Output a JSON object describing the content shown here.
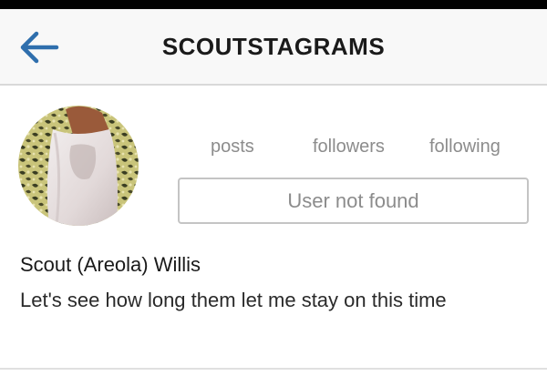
{
  "header": {
    "title": "SCOUTSTAGRAMS",
    "back_icon": "back-arrow-icon",
    "accent_color": "#2f6fad"
  },
  "profile": {
    "stats": {
      "posts_label": "posts",
      "followers_label": "followers",
      "following_label": "following"
    },
    "status_button_label": "User not found",
    "name": "Scout (Areola) Willis",
    "bio": "Let's see how long them let me stay on this time"
  }
}
